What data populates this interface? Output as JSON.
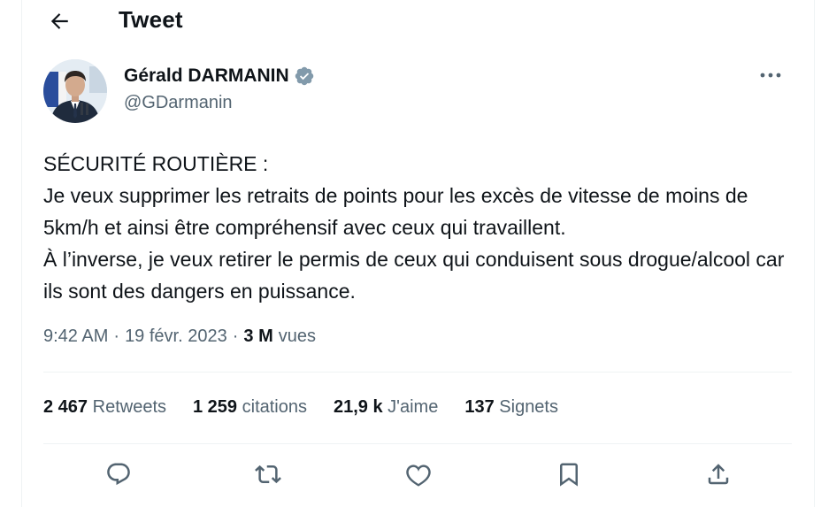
{
  "header": {
    "title": "Tweet"
  },
  "author": {
    "name": "Gérald DARMANIN",
    "handle": "@GDarmanin"
  },
  "tweet": {
    "text": "SÉCURITÉ ROUTIÈRE :\nJe veux supprimer les retraits de points pour les excès de vitesse de moins de 5km/h et ainsi être compréhensif avec ceux qui travaillent.\nÀ l’inverse, je veux retirer le permis de ceux qui conduisent sous drogue/alcool car ils sont des dangers en puissance.",
    "time": "9:42 AM",
    "date": "19 févr. 2023",
    "views_count": "3 M",
    "views_label": "vues"
  },
  "stats": {
    "retweets": {
      "count": "2 467",
      "label": "Retweets"
    },
    "quotes": {
      "count": "1 259",
      "label": "citations"
    },
    "likes": {
      "count": "21,9 k",
      "label": "J'aime"
    },
    "bookmarks": {
      "count": "137",
      "label": "Signets"
    }
  },
  "icons": {
    "back": "arrow-left-icon",
    "verified": "verified-badge-icon",
    "more": "more-horizontal-icon",
    "reply": "reply-icon",
    "retweet": "retweet-icon",
    "like": "heart-icon",
    "bookmark": "bookmark-icon",
    "share": "share-icon"
  },
  "colors": {
    "text": "#0f1419",
    "secondary": "#536471",
    "verified": "#829aab",
    "divider": "#eff3f4"
  }
}
